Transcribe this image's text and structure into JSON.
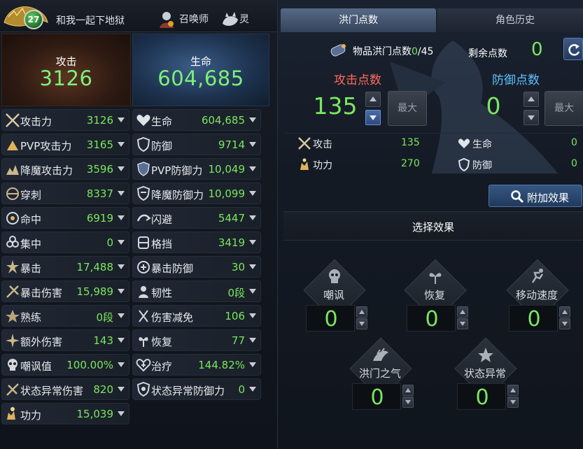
{
  "header": {
    "level": "27",
    "character_name": "和我一起下地狱",
    "class_name": "召唤师",
    "spirit_name": "灵"
  },
  "summary": {
    "attack_label": "攻击",
    "attack_value": "3126",
    "hp_label": "生命",
    "hp_value": "604,685"
  },
  "stats_left": [
    {
      "label": "攻击力",
      "value": "3126",
      "icon": "swords-icon"
    },
    {
      "label": "PVP攻击力",
      "value": "3165",
      "icon": "pvp-attack-icon"
    },
    {
      "label": "降魔攻击力",
      "value": "3596",
      "icon": "demon-attack-icon"
    },
    {
      "label": "穿刺",
      "value": "8337",
      "icon": "pierce-icon"
    },
    {
      "label": "命中",
      "value": "6919",
      "icon": "accuracy-icon"
    },
    {
      "label": "集中",
      "value": "0",
      "icon": "focus-icon"
    },
    {
      "label": "暴击",
      "value": "17,488",
      "icon": "critical-icon"
    },
    {
      "label": "暴击伤害",
      "value": "15,989",
      "icon": "critical-damage-icon"
    },
    {
      "label": "熟练",
      "value": "0段",
      "icon": "mastery-icon"
    },
    {
      "label": "额外伤害",
      "value": "143",
      "icon": "extra-damage-icon"
    },
    {
      "label": "嘲讽值",
      "value": "100.00%",
      "icon": "taunt-skull-icon"
    },
    {
      "label": "状态异常伤害",
      "value": "820",
      "icon": "status-damage-icon"
    },
    {
      "label": "功力",
      "value": "15,039",
      "icon": "power-icon"
    }
  ],
  "stats_right": [
    {
      "label": "生命",
      "value": "604,685",
      "icon": "heart-icon"
    },
    {
      "label": "防御",
      "value": "9714",
      "icon": "shield-icon"
    },
    {
      "label": "PVP防御力",
      "value": "10,049",
      "icon": "pvp-defense-icon"
    },
    {
      "label": "降魔防御力",
      "value": "10,099",
      "icon": "demon-defense-icon"
    },
    {
      "label": "闪避",
      "value": "5447",
      "icon": "evasion-icon"
    },
    {
      "label": "格挡",
      "value": "3419",
      "icon": "block-icon"
    },
    {
      "label": "暴击防御",
      "value": "30",
      "icon": "critical-defense-icon"
    },
    {
      "label": "韧性",
      "value": "0段",
      "icon": "toughness-icon"
    },
    {
      "label": "伤害减免",
      "value": "106",
      "icon": "damage-reduction-icon"
    },
    {
      "label": "恢复",
      "value": "77",
      "icon": "recovery-icon"
    },
    {
      "label": "治疗",
      "value": "144.82%",
      "icon": "heal-icon"
    },
    {
      "label": "状态异常防御力",
      "value": "0",
      "icon": "status-defense-icon"
    }
  ],
  "tabs": {
    "points": "洪门点数",
    "history": "角色历史"
  },
  "points": {
    "item_label": "物品洪门点数",
    "item_current": "0",
    "item_total": "/45",
    "remaining_label": "剩余点数",
    "remaining_value": "0",
    "attack_title": "攻击点数",
    "attack_points": "135",
    "defense_title": "防御点数",
    "defense_points": "0",
    "max_label": "最大"
  },
  "effects": {
    "attack": [
      {
        "label": "攻击",
        "value": "135"
      },
      {
        "label": "功力",
        "value": "270"
      }
    ],
    "defense": [
      {
        "label": "生命",
        "value": "0"
      },
      {
        "label": "防御",
        "value": "0"
      }
    ]
  },
  "extra_effect_label": "附加效果",
  "select_effect_title": "选择效果",
  "nodes": [
    {
      "label": "嘲讽",
      "value": "0",
      "icon": "skull-icon"
    },
    {
      "label": "恢复",
      "value": "0",
      "icon": "sprout-icon"
    },
    {
      "label": "移动速度",
      "value": "0",
      "icon": "running-icon"
    },
    {
      "label": "洪门之气",
      "value": "0",
      "icon": "dragon-icon"
    },
    {
      "label": "状态异常",
      "value": "0",
      "icon": "star-icon"
    }
  ],
  "colors": {
    "value_green": "#7be65f",
    "attack_red": "#ff6b5a",
    "defense_blue": "#5cc3ff"
  }
}
